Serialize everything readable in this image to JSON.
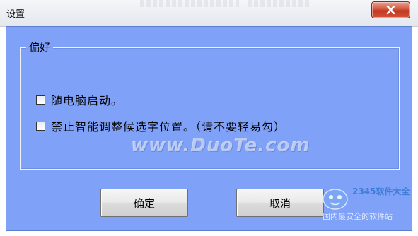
{
  "window": {
    "title": "设置",
    "close_icon": "close-icon"
  },
  "preferences": {
    "group_label": "偏好",
    "options": [
      {
        "label": "随电脑启动。",
        "checked": false
      },
      {
        "label": "禁止智能调整候选字位置。（请不要轻易勾）",
        "checked": false
      }
    ]
  },
  "buttons": {
    "ok_label": "确定",
    "cancel_label": "取消"
  },
  "watermark": {
    "text": "www.DuoTe.com"
  },
  "logo": {
    "brand_text": "2345软件大全",
    "slogan_text": "国内最安全的软件站"
  },
  "colors": {
    "client_background": "#7fa2f8",
    "close_button": "#c2371f"
  }
}
